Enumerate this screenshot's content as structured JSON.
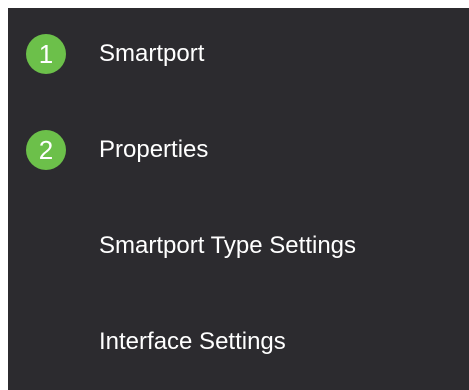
{
  "colors": {
    "panel_background": "#2c2b2f",
    "badge": "#6cc04a",
    "text": "#ffffff"
  },
  "menu": {
    "items": [
      {
        "step": "1",
        "label": "Smartport"
      },
      {
        "step": "2",
        "label": "Properties"
      },
      {
        "step": "",
        "label": "Smartport Type Settings"
      },
      {
        "step": "",
        "label": "Interface Settings"
      }
    ]
  }
}
